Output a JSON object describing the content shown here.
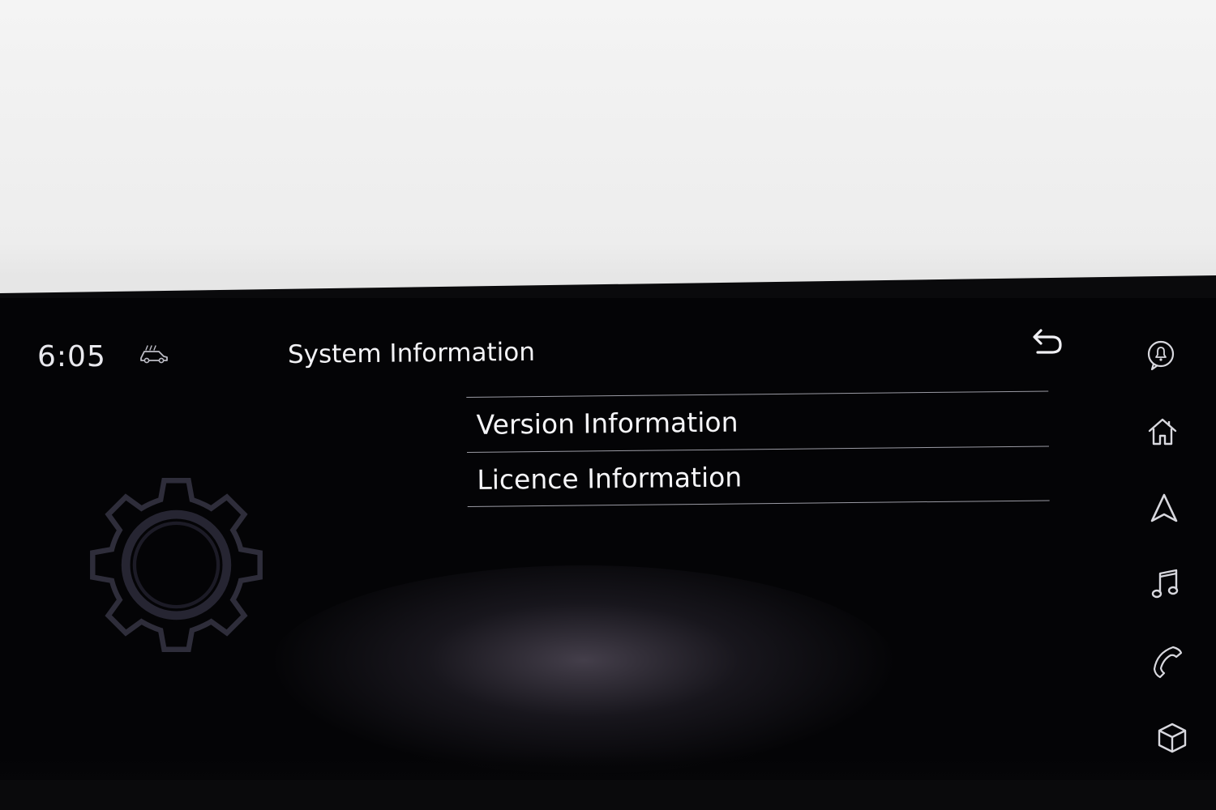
{
  "status_bar": {
    "clock": "6:05"
  },
  "header": {
    "title": "System Information"
  },
  "menu": {
    "items": [
      {
        "label": "Version Information"
      },
      {
        "label": "Licence Information"
      }
    ]
  },
  "icons": {
    "status": "car-icon",
    "back": "back-arrow-icon",
    "background": "gear-icon",
    "sidebar": [
      "notification-bell-icon",
      "home-icon",
      "navigation-icon",
      "music-icon",
      "phone-icon",
      "apps-cube-icon"
    ]
  },
  "colors": {
    "screen_background": "#040406",
    "text": "#f2f2f5",
    "divider": "#9a9aa3",
    "gear": "#2a2a36"
  }
}
